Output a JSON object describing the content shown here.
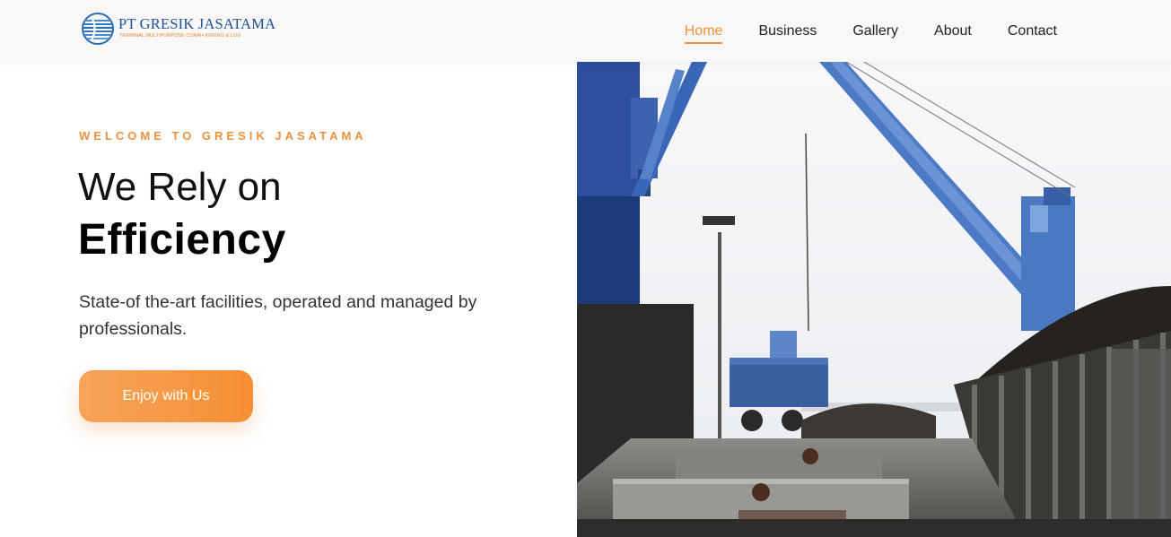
{
  "logo": {
    "name": "PT GRESIK JASATAMA",
    "tagline": "TERMINAL MULTIPURPOSE CURAH KERING & LOG"
  },
  "nav": {
    "items": [
      {
        "label": "Home",
        "active": true
      },
      {
        "label": "Business",
        "active": false
      },
      {
        "label": "Gallery",
        "active": false
      },
      {
        "label": "About",
        "active": false
      },
      {
        "label": "Contact",
        "active": false
      }
    ]
  },
  "hero": {
    "kicker": "WELCOME TO GRESIK JASATAMA",
    "title_light": "We Rely on",
    "title_bold": "Efficiency",
    "description": "State-of the-art facilities, operated and managed by professionals.",
    "cta_label": "Enjoy with Us",
    "image_icon": "port-crane-photo"
  },
  "colors": {
    "accent": "#f3913a",
    "brand_blue": "#1f4f8f"
  }
}
